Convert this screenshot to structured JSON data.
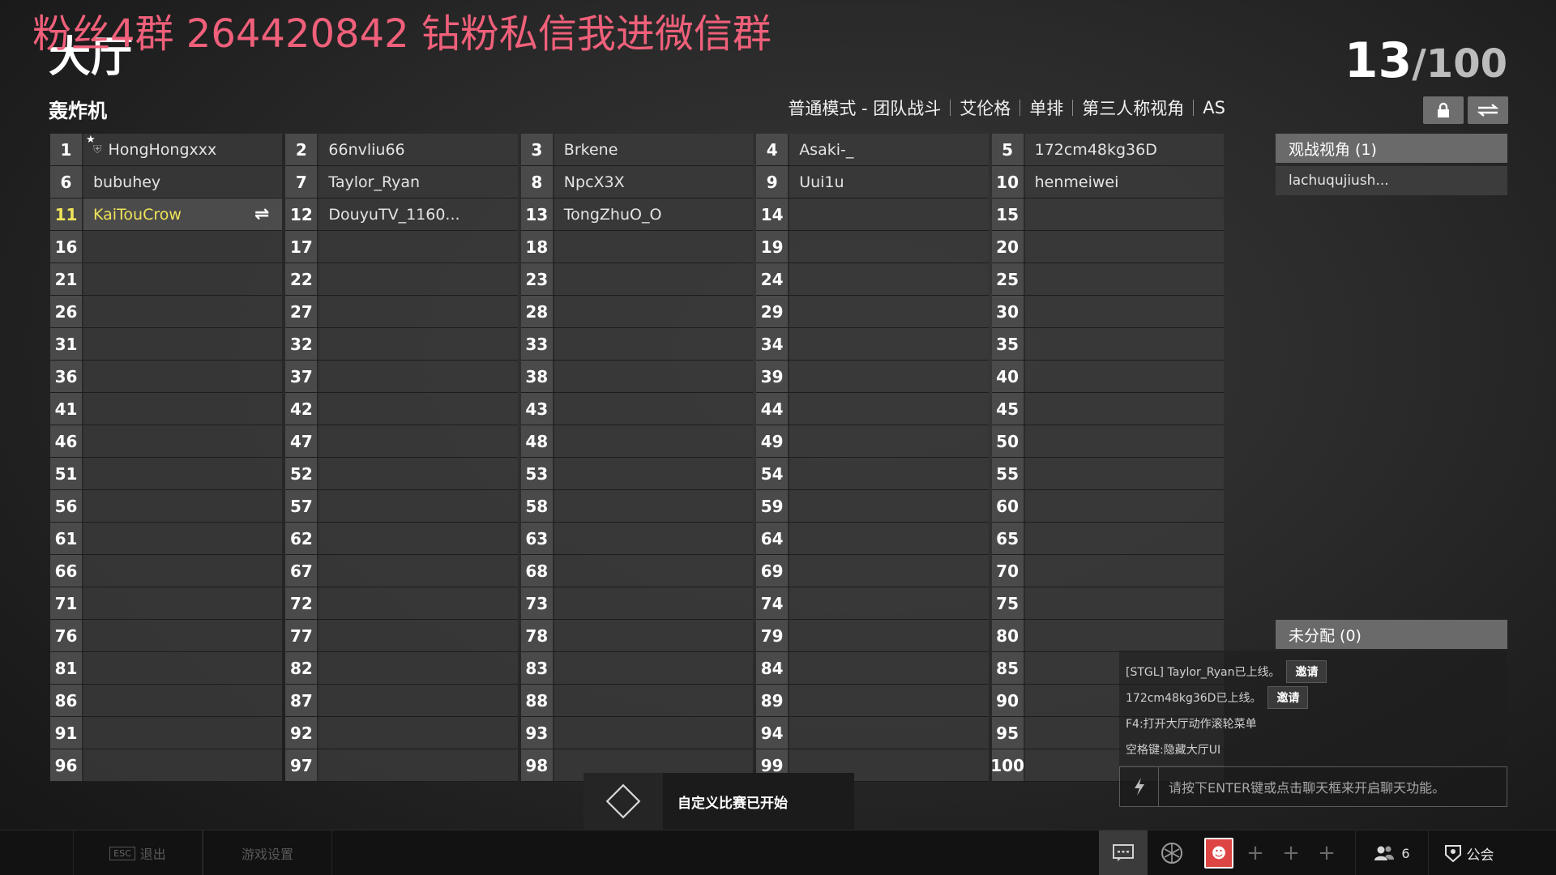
{
  "watermark": "粉丝4群 264420842 钻粉私信我进微信群",
  "title": "大厅",
  "player_count": {
    "current": "13",
    "total": "/100"
  },
  "map_name": "轰炸机",
  "mode_bar": [
    "普通模式 - 团队战斗",
    "艾伦格",
    "单排",
    "第三人称视角",
    "AS"
  ],
  "buttons": {
    "lock_icon": "lock-icon",
    "swap_icon": "swap-icon"
  },
  "slots": [
    {
      "n": "1",
      "name": "HongHongxxx",
      "star": true,
      "shield": true
    },
    {
      "n": "2",
      "name": "66nvliu66"
    },
    {
      "n": "3",
      "name": "Brkene"
    },
    {
      "n": "4",
      "name": "Asaki-_"
    },
    {
      "n": "5",
      "name": "172cm48kg36D"
    },
    {
      "n": "6",
      "name": "bubuhey"
    },
    {
      "n": "7",
      "name": "Taylor_Ryan"
    },
    {
      "n": "8",
      "name": "NpcX3X"
    },
    {
      "n": "9",
      "name": "Uui1u"
    },
    {
      "n": "10",
      "name": "henmeiwei"
    },
    {
      "n": "11",
      "name": "KaiTouCrow",
      "me": true,
      "swap": true
    },
    {
      "n": "12",
      "name": "DouyuTV_1160..."
    },
    {
      "n": "13",
      "name": "TongZhuO_O"
    },
    {
      "n": "14",
      "name": ""
    },
    {
      "n": "15",
      "name": ""
    },
    {
      "n": "16",
      "name": ""
    },
    {
      "n": "17",
      "name": ""
    },
    {
      "n": "18",
      "name": ""
    },
    {
      "n": "19",
      "name": ""
    },
    {
      "n": "20",
      "name": ""
    },
    {
      "n": "21",
      "name": ""
    },
    {
      "n": "22",
      "name": ""
    },
    {
      "n": "23",
      "name": ""
    },
    {
      "n": "24",
      "name": ""
    },
    {
      "n": "25",
      "name": ""
    },
    {
      "n": "26",
      "name": ""
    },
    {
      "n": "27",
      "name": ""
    },
    {
      "n": "28",
      "name": ""
    },
    {
      "n": "29",
      "name": ""
    },
    {
      "n": "30",
      "name": ""
    },
    {
      "n": "31",
      "name": ""
    },
    {
      "n": "32",
      "name": ""
    },
    {
      "n": "33",
      "name": ""
    },
    {
      "n": "34",
      "name": ""
    },
    {
      "n": "35",
      "name": ""
    },
    {
      "n": "36",
      "name": ""
    },
    {
      "n": "37",
      "name": ""
    },
    {
      "n": "38",
      "name": ""
    },
    {
      "n": "39",
      "name": ""
    },
    {
      "n": "40",
      "name": ""
    },
    {
      "n": "41",
      "name": ""
    },
    {
      "n": "42",
      "name": ""
    },
    {
      "n": "43",
      "name": ""
    },
    {
      "n": "44",
      "name": ""
    },
    {
      "n": "45",
      "name": ""
    },
    {
      "n": "46",
      "name": ""
    },
    {
      "n": "47",
      "name": ""
    },
    {
      "n": "48",
      "name": ""
    },
    {
      "n": "49",
      "name": ""
    },
    {
      "n": "50",
      "name": ""
    },
    {
      "n": "51",
      "name": ""
    },
    {
      "n": "52",
      "name": ""
    },
    {
      "n": "53",
      "name": ""
    },
    {
      "n": "54",
      "name": ""
    },
    {
      "n": "55",
      "name": ""
    },
    {
      "n": "56",
      "name": ""
    },
    {
      "n": "57",
      "name": ""
    },
    {
      "n": "58",
      "name": ""
    },
    {
      "n": "59",
      "name": ""
    },
    {
      "n": "60",
      "name": ""
    },
    {
      "n": "61",
      "name": ""
    },
    {
      "n": "62",
      "name": ""
    },
    {
      "n": "63",
      "name": ""
    },
    {
      "n": "64",
      "name": ""
    },
    {
      "n": "65",
      "name": ""
    },
    {
      "n": "66",
      "name": ""
    },
    {
      "n": "67",
      "name": ""
    },
    {
      "n": "68",
      "name": ""
    },
    {
      "n": "69",
      "name": ""
    },
    {
      "n": "70",
      "name": ""
    },
    {
      "n": "71",
      "name": ""
    },
    {
      "n": "72",
      "name": ""
    },
    {
      "n": "73",
      "name": ""
    },
    {
      "n": "74",
      "name": ""
    },
    {
      "n": "75",
      "name": ""
    },
    {
      "n": "76",
      "name": ""
    },
    {
      "n": "77",
      "name": ""
    },
    {
      "n": "78",
      "name": ""
    },
    {
      "n": "79",
      "name": ""
    },
    {
      "n": "80",
      "name": ""
    },
    {
      "n": "81",
      "name": ""
    },
    {
      "n": "82",
      "name": ""
    },
    {
      "n": "83",
      "name": ""
    },
    {
      "n": "84",
      "name": ""
    },
    {
      "n": "85",
      "name": ""
    },
    {
      "n": "86",
      "name": ""
    },
    {
      "n": "87",
      "name": ""
    },
    {
      "n": "88",
      "name": ""
    },
    {
      "n": "89",
      "name": ""
    },
    {
      "n": "90",
      "name": ""
    },
    {
      "n": "91",
      "name": ""
    },
    {
      "n": "92",
      "name": ""
    },
    {
      "n": "93",
      "name": ""
    },
    {
      "n": "94",
      "name": ""
    },
    {
      "n": "95",
      "name": ""
    },
    {
      "n": "96",
      "name": ""
    },
    {
      "n": "97",
      "name": ""
    },
    {
      "n": "98",
      "name": ""
    },
    {
      "n": "99",
      "name": ""
    },
    {
      "n": "100",
      "name": ""
    }
  ],
  "spectators": {
    "header": "观战视角 (1)",
    "items": [
      "lachuqujiush..."
    ]
  },
  "unassigned": {
    "header": "未分配 (0)"
  },
  "chat": {
    "lines": [
      {
        "text": "[STGL] Taylor_Ryan已上线。",
        "button": "邀请"
      },
      {
        "text": "172cm48kg36D已上线。",
        "button": "邀请"
      },
      {
        "text": "F4:打开大厅动作滚轮菜单"
      },
      {
        "text": "空格键:隐藏大厅UI"
      }
    ],
    "input_placeholder": "请按下ENTER键或点击聊天框来开启聊天功能。"
  },
  "notice": {
    "text": "自定义比赛已开始"
  },
  "bottom": {
    "esc_key": "ESC",
    "exit_label": "退出",
    "settings_label": "游戏设置",
    "friends_count": "6",
    "guild_label": "公会"
  },
  "colors": {
    "accent_me": "#f0e35a",
    "watermark": "#f0607a"
  }
}
